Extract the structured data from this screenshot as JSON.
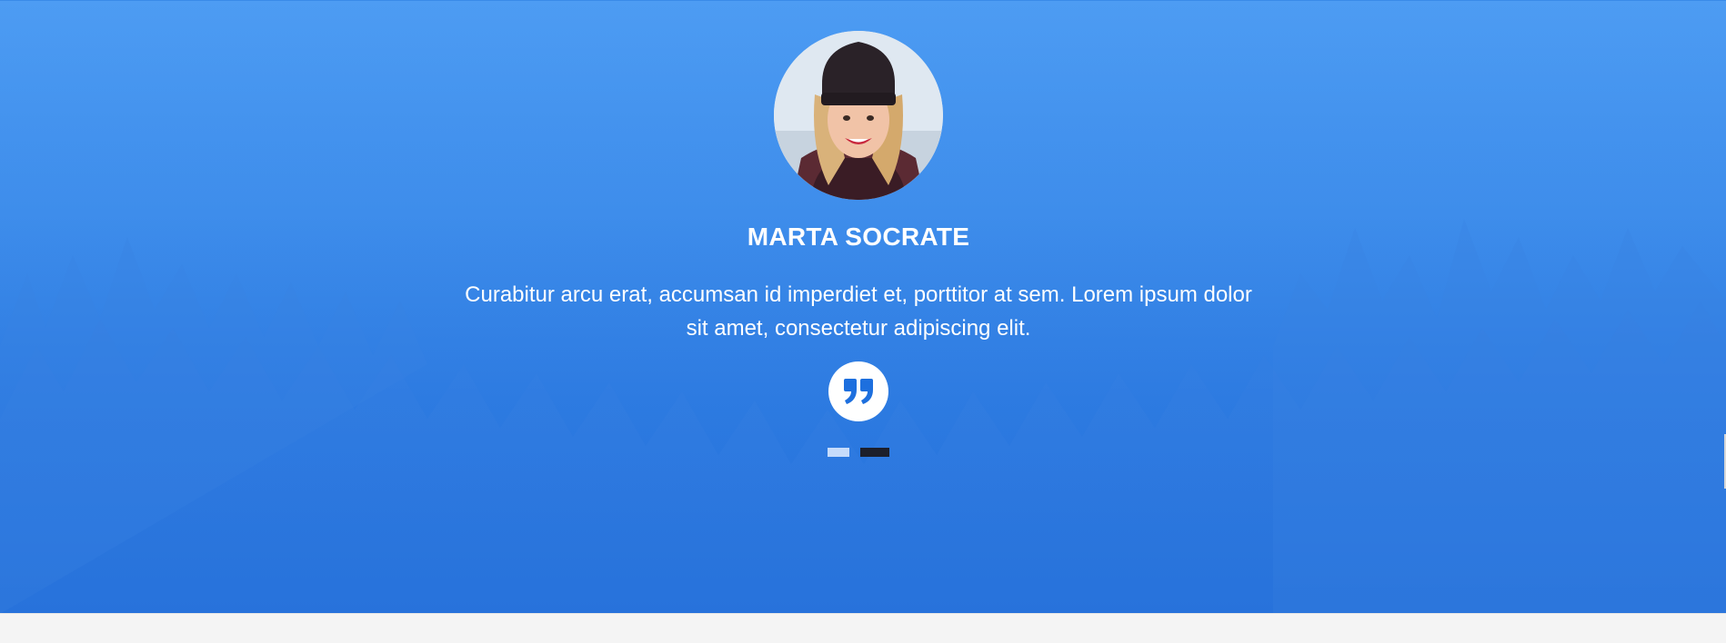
{
  "testimonial": {
    "name": "MARTA SOCRATE",
    "quote": "Curabitur arcu erat, accumsan id imperdiet et, porttitor at sem. Lorem ipsum dolor sit amet, consectetur adipiscing elit.",
    "avatar_icon": "person-photo",
    "quote_icon": "quote-icon"
  },
  "carousel": {
    "slide_count": 2,
    "active_slide": 2
  },
  "colors": {
    "background_top": "#4d9cf3",
    "background_bottom": "#2370dd",
    "text": "#ffffff",
    "quote_badge": "#ffffff",
    "quote_glyph": "#1d6fde",
    "dot_inactive": "#c6dcfb",
    "dot_active": "#1c1f2b"
  }
}
